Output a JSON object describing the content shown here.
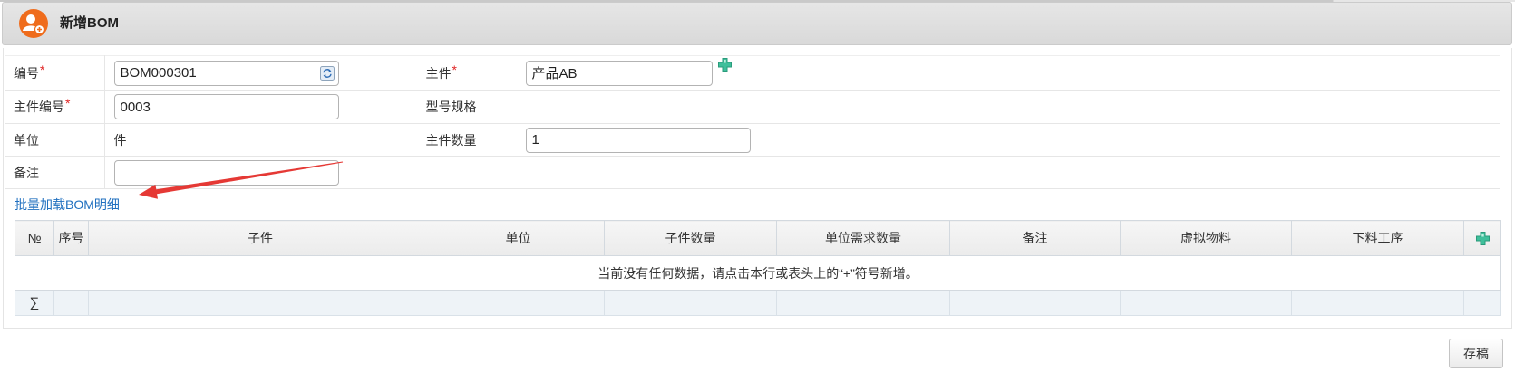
{
  "colors": {
    "header_icon": "#ef6c1c",
    "required": "#e02424",
    "link": "#1f6fbf",
    "plus_icon": "#3fbf9b",
    "annotation_arrow": "#e53935"
  },
  "header": {
    "title": "新增BOM",
    "icon": "user-add-icon"
  },
  "form": {
    "code": {
      "label": "编号",
      "required": "*",
      "value": "BOM000301",
      "icon": "refresh-icon"
    },
    "main_item": {
      "label": "主件",
      "required": "*",
      "value": "产品AB",
      "icon": "plus-icon"
    },
    "main_item_code": {
      "label": "主件编号",
      "required": "*",
      "value": "0003"
    },
    "model_spec": {
      "label": "型号规格"
    },
    "unit": {
      "label": "单位",
      "value": "件"
    },
    "main_qty": {
      "label": "主件数量",
      "value": "1"
    },
    "remark": {
      "label": "备注",
      "value": ""
    }
  },
  "batch_load": {
    "label": "批量加载BOM明细"
  },
  "grid": {
    "columns": [
      "№",
      "序号",
      "子件",
      "单位",
      "子件数量",
      "单位需求数量",
      "备注",
      "虚拟物料",
      "下料工序"
    ],
    "add_icon": "plus-icon",
    "empty_message": "当前没有任何数据，请点击本行或表头上的“+”符号新增。",
    "sum_symbol": "∑"
  },
  "footer": {
    "save_draft": "存稿"
  }
}
